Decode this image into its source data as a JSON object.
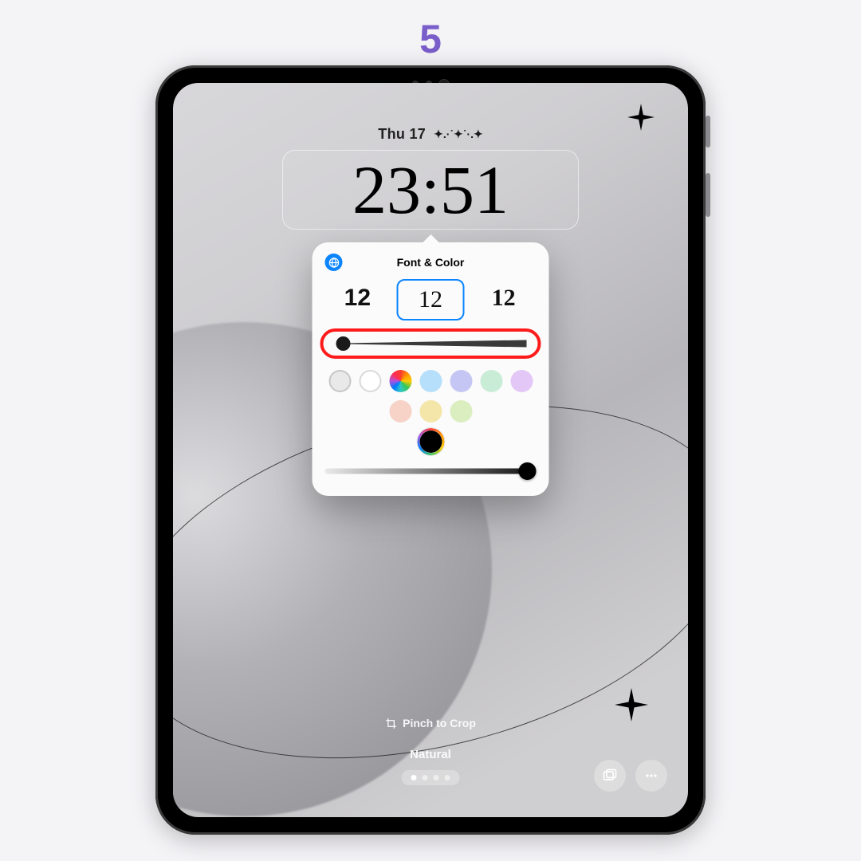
{
  "step_number": "5",
  "lockscreen": {
    "date_label": "Thu 17",
    "date_decoration": "✦.·˙✦˙·.✦",
    "time": "23:51"
  },
  "popover": {
    "title": "Font & Color",
    "globe_icon": "globe-icon",
    "font_options": [
      {
        "sample": "12",
        "selected": false
      },
      {
        "sample": "12",
        "selected": true
      },
      {
        "sample": "12",
        "selected": false
      }
    ],
    "weight_slider": {
      "value_percent": 2,
      "highlighted": true
    },
    "colors_row1": [
      "#e9e9e9",
      "#ffffff",
      "rainbow",
      "#b5dffb",
      "#c5c6f3",
      "#c9ecd7"
    ],
    "colors_row2": [
      "#e3c7f6",
      "#f6d3c6",
      "#f4e5a8",
      "#dbeec0"
    ],
    "color_picker_current": "#000000",
    "opacity_slider": {
      "value_percent": 98
    }
  },
  "bottom": {
    "hint_label": "Pinch to Crop",
    "mode_label": "Natural",
    "page_count": 4,
    "page_index": 0,
    "photos_button": "photos-icon",
    "more_button": "more-icon"
  }
}
